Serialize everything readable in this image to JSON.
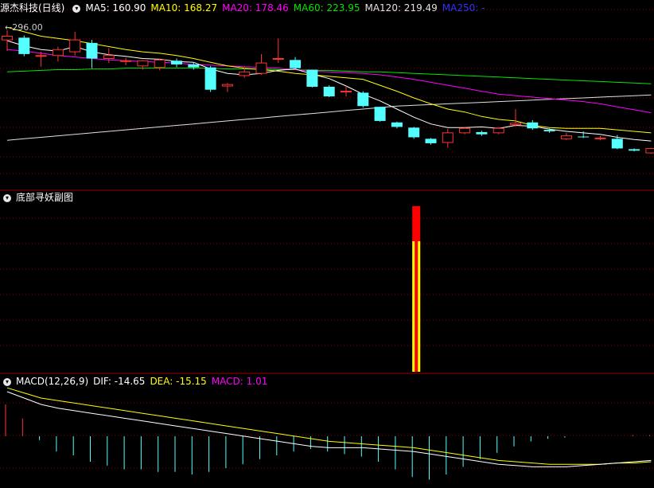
{
  "colors": {
    "up": "#ff3232",
    "down": "#54ffff",
    "ma5": "#ffffff",
    "ma10": "#ffff00",
    "ma20": "#ff00ff",
    "ma60": "#00e600",
    "ma120": "#e0e0e0",
    "ma250": "#0000ff",
    "grid": "#8b0000",
    "divider": "#a00000",
    "dif": "#ffffff",
    "dea": "#ffff00",
    "macd_label": "#ff00ff"
  },
  "main": {
    "title": "源杰科技(日线)",
    "ma5": "MA5: 160.90",
    "ma10": "MA10: 168.27",
    "ma20": "MA20: 178.46",
    "ma60": "MA60: 223.95",
    "ma120": "MA120: 219.49",
    "ma250": "MA250: -",
    "max_price_label": "←296.00"
  },
  "sub": {
    "title": "底部寻妖副图"
  },
  "macd": {
    "name": "MACD(12,26,9)",
    "dif": "DIF: -14.65",
    "dea": "DEA: -15.15",
    "macd": "MACD: 1.01"
  },
  "chart_data": {
    "type": "candlestick",
    "candles": [
      {
        "o": 283,
        "h": 296,
        "l": 268,
        "c": 288
      },
      {
        "o": 286,
        "h": 289,
        "l": 261,
        "c": 264
      },
      {
        "o": 262,
        "h": 267,
        "l": 247,
        "c": 262
      },
      {
        "o": 262,
        "h": 274,
        "l": 254,
        "c": 270
      },
      {
        "o": 267,
        "h": 294,
        "l": 262,
        "c": 283
      },
      {
        "o": 279,
        "h": 283,
        "l": 245,
        "c": 258
      },
      {
        "o": 258,
        "h": 272,
        "l": 252,
        "c": 262
      },
      {
        "o": 255,
        "h": 259,
        "l": 249,
        "c": 255
      },
      {
        "o": 248,
        "h": 256,
        "l": 243,
        "c": 255
      },
      {
        "o": 246,
        "h": 258,
        "l": 242,
        "c": 256
      },
      {
        "o": 255,
        "h": 258,
        "l": 246,
        "c": 250
      },
      {
        "o": 250,
        "h": 253,
        "l": 243,
        "c": 246
      },
      {
        "o": 246,
        "h": 248,
        "l": 213,
        "c": 216
      },
      {
        "o": 221,
        "h": 225,
        "l": 213,
        "c": 223
      },
      {
        "o": 235,
        "h": 246,
        "l": 232,
        "c": 240
      },
      {
        "o": 238,
        "h": 264,
        "l": 236,
        "c": 252
      },
      {
        "o": 258,
        "h": 285,
        "l": 252,
        "c": 258
      },
      {
        "o": 256,
        "h": 260,
        "l": 244,
        "c": 245
      },
      {
        "o": 243,
        "h": 243,
        "l": 219,
        "c": 220
      },
      {
        "o": 220,
        "h": 222,
        "l": 206,
        "c": 207
      },
      {
        "o": 214,
        "h": 221,
        "l": 207,
        "c": 214
      },
      {
        "o": 212,
        "h": 214,
        "l": 192,
        "c": 194
      },
      {
        "o": 193,
        "h": 193,
        "l": 173,
        "c": 174
      },
      {
        "o": 172,
        "h": 173,
        "l": 164,
        "c": 166
      },
      {
        "o": 165,
        "h": 166,
        "l": 150,
        "c": 152
      },
      {
        "o": 150,
        "h": 151,
        "l": 142,
        "c": 144
      },
      {
        "o": 145,
        "h": 163,
        "l": 138,
        "c": 158
      },
      {
        "o": 158,
        "h": 166,
        "l": 156,
        "c": 164
      },
      {
        "o": 159,
        "h": 161,
        "l": 154,
        "c": 156
      },
      {
        "o": 158,
        "h": 166,
        "l": 156,
        "c": 164
      },
      {
        "o": 169,
        "h": 190,
        "l": 167,
        "c": 171
      },
      {
        "o": 172,
        "h": 175,
        "l": 162,
        "c": 164
      },
      {
        "o": 162,
        "h": 164,
        "l": 158,
        "c": 160
      },
      {
        "o": 150,
        "h": 158,
        "l": 148,
        "c": 154
      },
      {
        "o": 153,
        "h": 160,
        "l": 151,
        "c": 152
      },
      {
        "o": 150,
        "h": 154,
        "l": 148,
        "c": 151
      },
      {
        "o": 150,
        "h": 155,
        "l": 136,
        "c": 137
      },
      {
        "o": 136,
        "h": 137,
        "l": 133,
        "c": 134
      },
      {
        "o": 131,
        "h": 138,
        "l": 130,
        "c": 137
      }
    ],
    "ma5": [
      282,
      275,
      270,
      268,
      274,
      267,
      263,
      261,
      258,
      257,
      254,
      253,
      244,
      238,
      236,
      238,
      242,
      244,
      237,
      231,
      221,
      210,
      201,
      190,
      179,
      170,
      165,
      165,
      166,
      164,
      168,
      167,
      163,
      160,
      158,
      156,
      152,
      149,
      147
    ],
    "ma10": [
      300,
      294,
      288,
      285,
      282,
      278,
      274,
      270,
      267,
      265,
      262,
      258,
      253,
      248,
      245,
      243,
      241,
      238,
      236,
      234,
      232,
      230,
      222,
      214,
      205,
      197,
      190,
      186,
      180,
      176,
      174,
      168,
      165,
      164,
      164,
      164,
      162,
      160,
      158
    ],
    "ma20": [
      270,
      268,
      265,
      262,
      260,
      258,
      256,
      255,
      254,
      253,
      252,
      250,
      249,
      248,
      247,
      246,
      245,
      243,
      241,
      240,
      239,
      238,
      236,
      233,
      230,
      226,
      222,
      218,
      214,
      210,
      208,
      206,
      204,
      202,
      200,
      197,
      193,
      189,
      185
    ],
    "ma60": [
      240,
      241,
      242,
      243,
      243,
      244,
      244,
      245,
      245,
      245,
      245,
      245,
      245,
      244,
      244,
      244,
      243,
      243,
      242,
      242,
      241,
      240,
      240,
      239,
      238,
      237,
      236,
      235,
      234,
      233,
      232,
      231,
      230,
      229,
      228,
      227,
      226,
      225,
      224
    ],
    "ma120": [
      148,
      150,
      152,
      154,
      156,
      158,
      160,
      162,
      164,
      166,
      168,
      170,
      172,
      174,
      176,
      178,
      180,
      182,
      184,
      186,
      188,
      190,
      192,
      194,
      195,
      196,
      197,
      198,
      199,
      200,
      201,
      202,
      203,
      204,
      205,
      206,
      207,
      208,
      209
    ],
    "sub": [
      {
        "index": 24,
        "yellow": 0.95,
        "red_total": 1.0
      }
    ],
    "dif": [
      35,
      30,
      25,
      22,
      20,
      18,
      16,
      14,
      12,
      10,
      8,
      6,
      4,
      2,
      0,
      -2,
      -4,
      -6,
      -8,
      -9,
      -9,
      -9,
      -10,
      -11,
      -12,
      -14,
      -16,
      -18,
      -20,
      -22,
      -23,
      -24,
      -24,
      -24,
      -23,
      -22,
      -21,
      -20,
      -19
    ],
    "dea": [
      38,
      34,
      30,
      28,
      26,
      24,
      22,
      20,
      18,
      16,
      14,
      12,
      10,
      8,
      6,
      4,
      2,
      0,
      -2,
      -4,
      -5,
      -6,
      -7,
      -8,
      -9,
      -11,
      -13,
      -15,
      -17,
      -19,
      -20,
      -21,
      -22,
      -22,
      -22,
      -22,
      -21,
      -21,
      -20
    ],
    "macd": [
      25,
      14,
      -3,
      -12,
      -15,
      -20,
      -23,
      -26,
      -26,
      -28,
      -28,
      -30,
      -28,
      -25,
      -22,
      -18,
      -15,
      -12,
      -10,
      -12,
      -14,
      -16,
      -20,
      -26,
      -32,
      -34,
      -30,
      -24,
      -18,
      -13,
      -8,
      -4,
      -2,
      -1,
      0,
      0,
      0,
      1,
      1
    ]
  }
}
